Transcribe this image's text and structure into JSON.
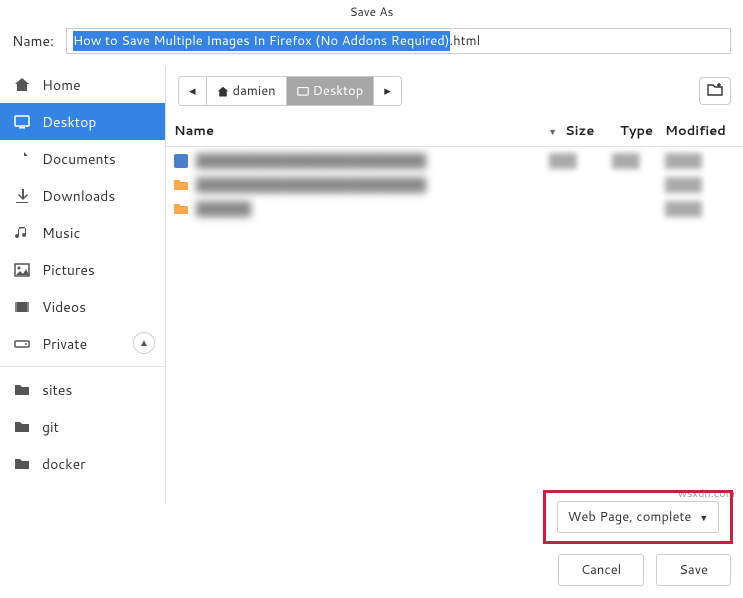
{
  "title": "Save As",
  "name_label": "Name:",
  "filename_selected": "How to Save Multiple Images In Firefox (No Addons Required)",
  "filename_suffix": ".html",
  "sidebar": {
    "items": [
      {
        "label": "Home",
        "icon": "home-icon"
      },
      {
        "label": "Desktop",
        "icon": "desktop-icon"
      },
      {
        "label": "Documents",
        "icon": "documents-icon"
      },
      {
        "label": "Downloads",
        "icon": "downloads-icon"
      },
      {
        "label": "Music",
        "icon": "music-icon"
      },
      {
        "label": "Pictures",
        "icon": "pictures-icon"
      },
      {
        "label": "Videos",
        "icon": "videos-icon"
      },
      {
        "label": "Private",
        "icon": "drive-icon"
      }
    ],
    "extra": [
      {
        "label": "sites",
        "icon": "folder-icon"
      },
      {
        "label": "git",
        "icon": "folder-icon"
      },
      {
        "label": "docker",
        "icon": "folder-icon"
      }
    ]
  },
  "path": {
    "back": "◂",
    "segments": [
      {
        "label": "damien",
        "icon": "home-icon"
      },
      {
        "label": "Desktop",
        "icon": "desktop-small-icon",
        "active": true
      }
    ],
    "forward": "▸"
  },
  "columns": {
    "name": "Name",
    "size": "Size",
    "type": "Type",
    "modified": "Modified"
  },
  "files": [
    {
      "icon": "doc",
      "name": "█████████████████████████",
      "size": "███",
      "type": "███",
      "mod": "████"
    },
    {
      "icon": "folder",
      "name": "█████████████████████████",
      "size": "",
      "type": "",
      "mod": "████"
    },
    {
      "icon": "folder",
      "name": "██████",
      "size": "",
      "type": "",
      "mod": "████"
    }
  ],
  "filetype": {
    "label": "Web Page, complete"
  },
  "buttons": {
    "cancel": "Cancel",
    "save": "Save"
  },
  "watermark": "wsxdn.com"
}
